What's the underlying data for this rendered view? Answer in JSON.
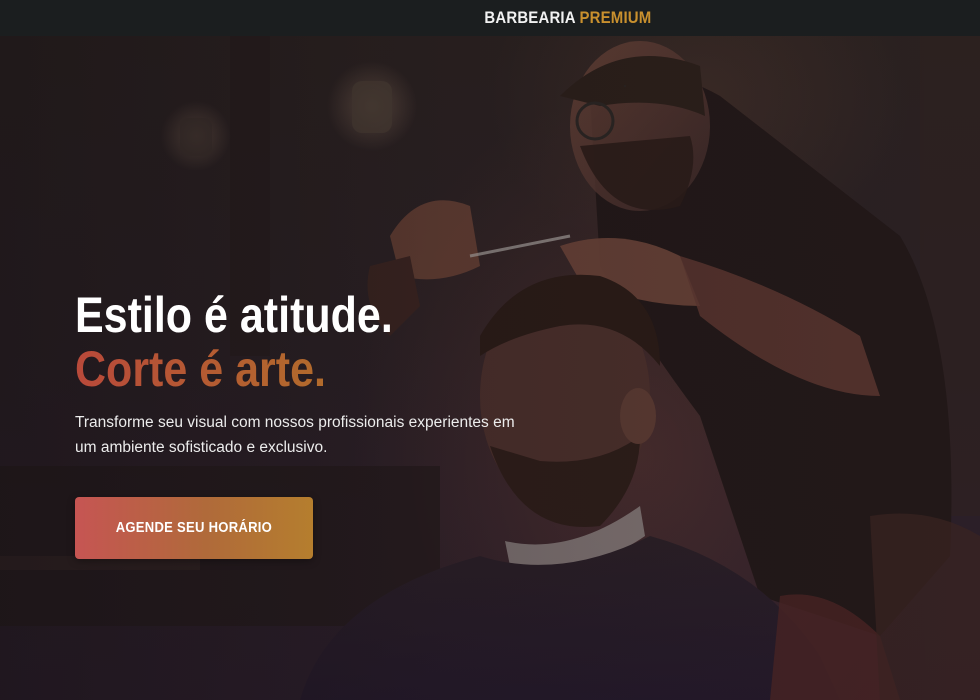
{
  "header": {
    "brand_main": "BARBEARIA",
    "brand_accent": "PREMIUM"
  },
  "hero": {
    "headline_line1": "Estilo é atitude.",
    "headline_line2": "Corte é arte.",
    "subtitle": "Transforme seu visual com nossos profissionais experientes em um ambiente sofisticado e exclusivo.",
    "cta_label": "AGENDE SEU HORÁRIO",
    "background_image": "barber-cutting-hair-photo"
  },
  "colors": {
    "header_bg": "#1b1e1f",
    "brand_accent": "#c9902e",
    "headline_white": "#ffffff",
    "headline_gradient_start": "#b8493a",
    "headline_gradient_end": "#c58a2a",
    "cta_gradient_start": "#c65553",
    "cta_gradient_end": "#b57e2e"
  }
}
